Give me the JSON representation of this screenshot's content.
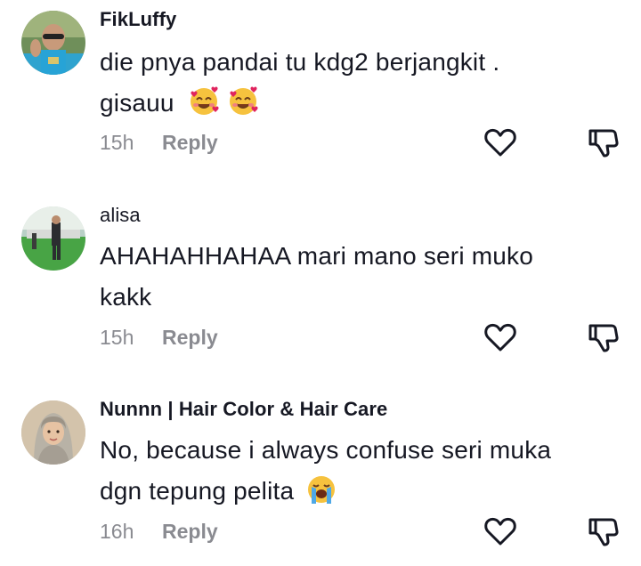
{
  "comments": [
    {
      "username": "FikLuffy",
      "text_line1": "die pnya pandai tu kdg2 berjangkit .",
      "text_line2": "gisauu",
      "emojis": [
        "smiling-face-with-hearts",
        "smiling-face-with-hearts"
      ],
      "time": "15h",
      "reply_label": "Reply"
    },
    {
      "username": "alisa",
      "text_line1": "AHAHAHHAHAA mari mano seri muko",
      "text_line2": "kakk",
      "emojis": [],
      "time": "15h",
      "reply_label": "Reply"
    },
    {
      "username": "Nunnn | Hair Color & Hair Care",
      "text_line1": "No, because i always confuse seri muka",
      "text_line2": "dgn tepung pelita",
      "emojis": [
        "loudly-crying-face"
      ],
      "time": "16h",
      "reply_label": "Reply"
    }
  ],
  "icons": {
    "like": "heart-outline-icon",
    "dislike": "thumbs-down-outline-icon"
  },
  "colors": {
    "text": "#161823",
    "muted": "#8a8b91",
    "icon": "#161823"
  }
}
